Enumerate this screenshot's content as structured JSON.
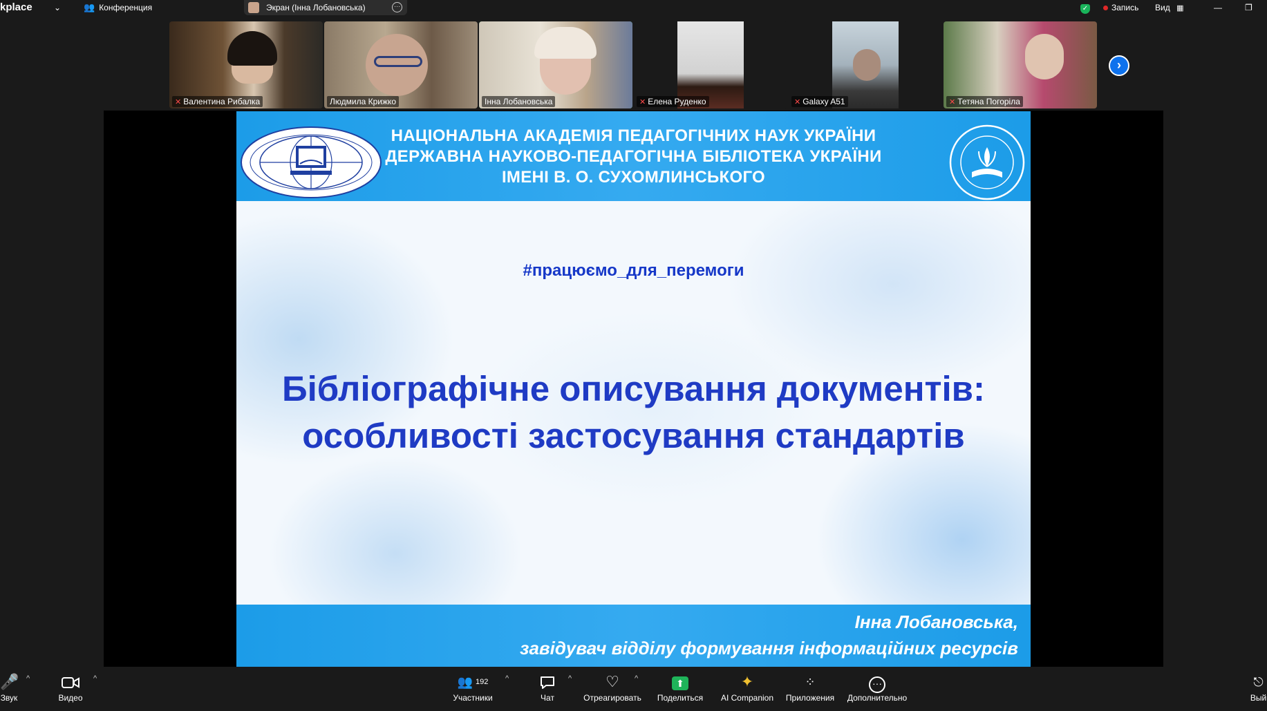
{
  "topbar": {
    "app_name": "kplace",
    "conference_label": "Конференция",
    "share_label": "Экран (Інна Лобановська)",
    "record_label": "Запись",
    "view_label": "Вид"
  },
  "participants": [
    {
      "name": "Валентина Рибалка",
      "muted": true
    },
    {
      "name": "Людмила Крижко",
      "muted": false
    },
    {
      "name": "Інна Лобановська",
      "muted": false,
      "active_speaker": true
    },
    {
      "name": "Елена Руденко",
      "muted": true
    },
    {
      "name": "Galaxy A51",
      "muted": true
    },
    {
      "name": "Тетяна Погоріла",
      "muted": true
    }
  ],
  "slide": {
    "header_lines": [
      "НАЦІОНАЛЬНА АКАДЕМІЯ ПЕДАГОГІЧНИХ НАУК УКРАЇНИ",
      "ДЕРЖАВНА НАУКОВО-ПЕДАГОГІЧНА БІБЛІОТЕКА УКРАЇНИ",
      "ІМЕНІ В. О. СУХОМЛИНСЬКОГО"
    ],
    "hashtag": "#працюємо_для_перемоги",
    "title_lines": [
      "Бібліографічне описування документів:",
      "особливості застосування стандартів"
    ],
    "author": "Інна Лобановська,",
    "author_role": "завідувач відділу формування інформаційних ресурсів"
  },
  "toolbar": {
    "audio_label": "Звук",
    "video_label": "Видео",
    "participants_label": "Участники",
    "participants_count": "192",
    "chat_label": "Чат",
    "react_label": "Отреагировать",
    "share_label": "Поделиться",
    "ai_label": "AI Companion",
    "apps_label": "Приложения",
    "more_label": "Дополнительно",
    "leave_label": "Вый"
  },
  "colors": {
    "accent_green": "#19b35a",
    "slide_blue": "#1c9ce8",
    "title_blue": "#1f3bc4",
    "share_green": "#1fb45a",
    "record_red": "#e02828"
  }
}
